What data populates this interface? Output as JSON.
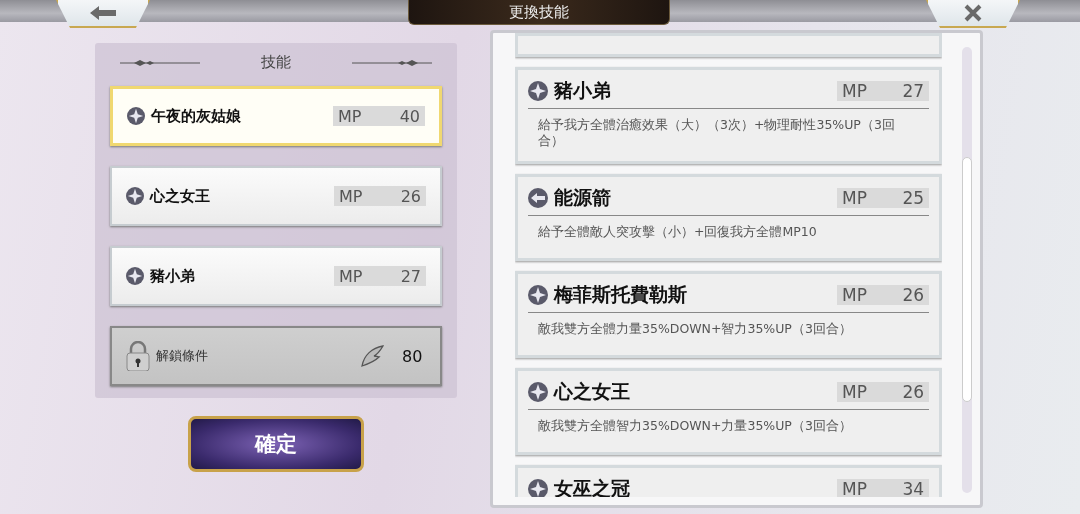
{
  "top_bar": {
    "title": "更換技能"
  },
  "skill_slots": {
    "title": "技能",
    "slots": [
      {
        "kind": "star",
        "name": "午夜的灰姑娘",
        "mp_label": "MP",
        "mp": "40",
        "selected": true
      },
      {
        "kind": "star",
        "name": "心之女王",
        "mp_label": "MP",
        "mp": "26",
        "selected": false
      },
      {
        "kind": "star",
        "name": "豬小弟",
        "mp_label": "MP",
        "mp": "27",
        "selected": false
      }
    ],
    "locked_slot": {
      "label": "解鎖條件",
      "cost": "80"
    }
  },
  "confirm_button": "確定",
  "skill_list": [
    {
      "kind": "star",
      "name": "豬小弟",
      "mp_label": "MP",
      "mp": "27",
      "description": "給予我方全體治癒效果（大）（3次）+物理耐性35%UP（3回合）"
    },
    {
      "kind": "arrow",
      "name": "能源箭",
      "mp_label": "MP",
      "mp": "25",
      "description": "給予全體敵人突攻擊（小）+回復我方全體MP10"
    },
    {
      "kind": "star",
      "name": "梅菲斯托費勒斯",
      "mp_label": "MP",
      "mp": "26",
      "description": "敵我雙方全體力量35%DOWN+智力35%UP（3回合）"
    },
    {
      "kind": "star",
      "name": "心之女王",
      "mp_label": "MP",
      "mp": "26",
      "description": "敵我雙方全體智力35%DOWN+力量35%UP（3回合）"
    },
    {
      "kind": "star",
      "name": "女巫之冠",
      "mp_label": "MP",
      "mp": "34"
    }
  ]
}
